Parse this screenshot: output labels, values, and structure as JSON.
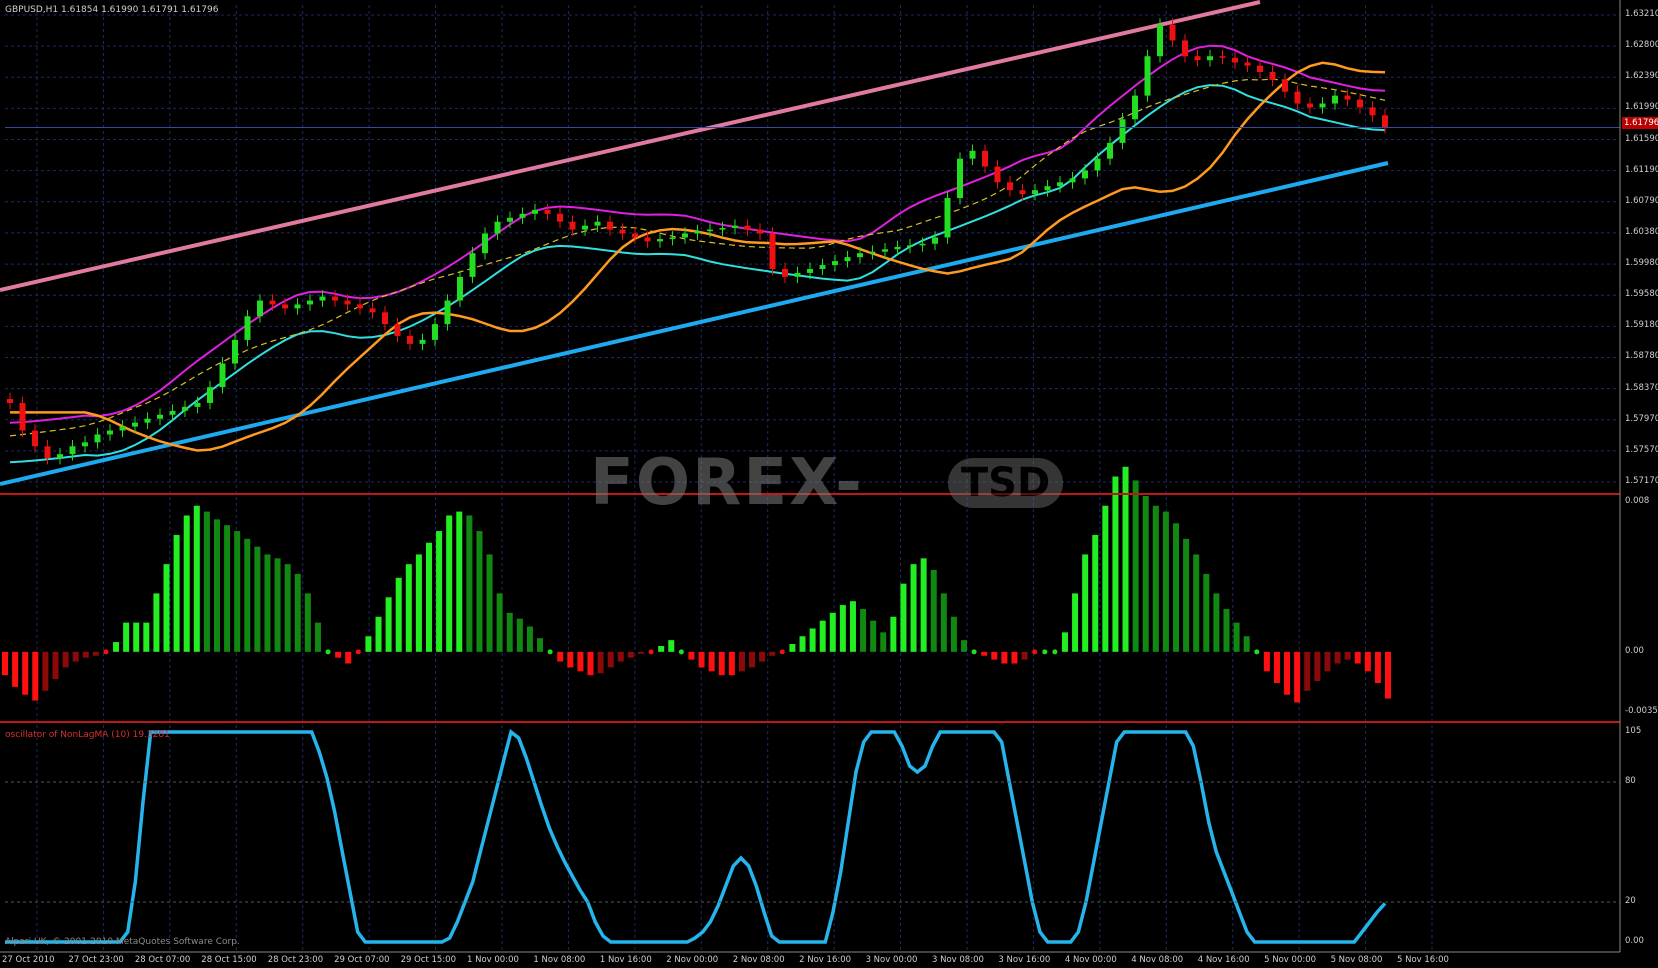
{
  "window": {
    "title": "GBPUSD,H1  1.61854 1.61990 1.61791 1.61796"
  },
  "indicator": {
    "title": "oscillator of NonLagMA (10) 19.3281"
  },
  "footer": {
    "copyright": "Alpari UK, © 2001-2010 MetaQuotes Software Corp."
  },
  "watermark": {
    "main": "FOREX-",
    "badge": "TSD"
  },
  "price_axis": [
    "1.63210",
    "1.62800",
    "1.62390",
    "1.61990",
    "1.61590",
    "1.61190",
    "1.60790",
    "1.60380",
    "1.59980",
    "1.59580",
    "1.59180",
    "1.58780",
    "1.58370",
    "1.57970",
    "1.57570",
    "1.57170"
  ],
  "current_price": "1.61796",
  "hist_axis": [
    "0.008",
    "0.00",
    "-0.0035"
  ],
  "osc_axis": [
    "105",
    "80",
    "20",
    "0.00"
  ],
  "time_axis": [
    "27 Oct 2010",
    "27 Oct 23:00",
    "28 Oct 07:00",
    "28 Oct 15:00",
    "28 Oct 23:00",
    "29 Oct 07:00",
    "29 Oct 15:00",
    "1 Nov 00:00",
    "1 Nov 08:00",
    "1 Nov 16:00",
    "2 Nov 00:00",
    "2 Nov 08:00",
    "2 Nov 16:00",
    "3 Nov 00:00",
    "3 Nov 08:00",
    "3 Nov 16:00",
    "4 Nov 00:00",
    "4 Nov 08:00",
    "4 Nov 16:00",
    "5 Nov 00:00",
    "5 Nov 08:00",
    "5 Nov 16:00"
  ],
  "colors": {
    "bull": "#22dd22",
    "bear": "#ee1111",
    "channel": "#e07aa0",
    "support": "#1eaaf0",
    "band_upper": "#e020e0",
    "band_lower": "#30e0e0",
    "orange_ma": "#ff9a20",
    "dashed_ma": "#d8c020",
    "grid": "#1c2a66",
    "osc_line": "#25b5ec"
  },
  "chart_data": [
    {
      "type": "candlestick",
      "title": "GBPUSD,H1",
      "ylim": [
        1.5717,
        1.6335
      ],
      "x_range": [
        "27 Oct 2010",
        "5 Nov 16:00"
      ],
      "close": [
        1.583,
        1.5795,
        1.5775,
        1.576,
        1.5765,
        1.5775,
        1.578,
        1.579,
        1.5795,
        1.58,
        1.5805,
        1.581,
        1.5815,
        1.582,
        1.5825,
        1.583,
        1.585,
        1.588,
        1.591,
        1.594,
        1.596,
        1.5955,
        1.595,
        1.5955,
        1.596,
        1.5965,
        1.596,
        1.5955,
        1.595,
        1.5945,
        1.593,
        1.5915,
        1.5905,
        1.591,
        1.593,
        1.596,
        1.599,
        1.602,
        1.6045,
        1.606,
        1.6065,
        1.607,
        1.6075,
        1.607,
        1.606,
        1.605,
        1.6055,
        1.606,
        1.605,
        1.6045,
        1.604,
        1.6035,
        1.6038,
        1.604,
        1.6045,
        1.6048,
        1.605,
        1.6052,
        1.6055,
        1.605,
        1.6045,
        1.6,
        1.599,
        1.5995,
        1.6,
        1.6005,
        1.601,
        1.6015,
        1.602,
        1.6022,
        1.6025,
        1.6028,
        1.603,
        1.6032,
        1.604,
        1.609,
        1.614,
        1.615,
        1.613,
        1.611,
        1.61,
        1.6095,
        1.61,
        1.6105,
        1.611,
        1.6115,
        1.6125,
        1.614,
        1.616,
        1.619,
        1.622,
        1.627,
        1.631,
        1.629,
        1.627,
        1.6265,
        1.627,
        1.6268,
        1.6262,
        1.6258,
        1.625,
        1.624,
        1.6225,
        1.621,
        1.6205,
        1.621,
        1.622,
        1.6215,
        1.6205,
        1.6195,
        1.618
      ],
      "current": 1.61796
    },
    {
      "type": "bar",
      "title": "",
      "ylim": [
        -0.0035,
        0.008
      ],
      "values": [
        -0.0012,
        -0.0018,
        -0.0022,
        -0.0025,
        -0.002,
        -0.0014,
        -0.0008,
        -0.0005,
        -0.0003,
        -0.0002,
        0.0,
        0.0005,
        0.0015,
        0.0015,
        0.0015,
        0.003,
        0.0045,
        0.006,
        0.007,
        0.0075,
        0.0072,
        0.0068,
        0.0065,
        0.0062,
        0.0058,
        0.0054,
        0.005,
        0.0048,
        0.0045,
        0.004,
        0.003,
        0.0015,
        0.0,
        -0.0003,
        -0.0006,
        0.0,
        0.0008,
        0.0018,
        0.0028,
        0.0038,
        0.0045,
        0.005,
        0.0056,
        0.0062,
        0.007,
        0.0072,
        0.007,
        0.0062,
        0.005,
        0.003,
        0.002,
        0.0017,
        0.0013,
        0.0007,
        0.0,
        -0.0005,
        -0.0008,
        -0.001,
        -0.0012,
        -0.0011,
        -0.0008,
        -0.0005,
        -0.0003,
        -0.0001,
        0.0,
        0.0003,
        0.0006,
        0.0,
        -0.0004,
        -0.0008,
        -0.001,
        -0.0012,
        -0.0012,
        -0.001,
        -0.0008,
        -0.0005,
        -0.0002,
        0.0,
        0.0004,
        0.0008,
        0.0012,
        0.0016,
        0.002,
        0.0024,
        0.0026,
        0.0022,
        0.0016,
        0.001,
        0.0018,
        0.0035,
        0.0045,
        0.0048,
        0.0042,
        0.003,
        0.0018,
        0.0006,
        0.0,
        -0.0002,
        -0.0004,
        -0.0006,
        -0.0006,
        -0.0004,
        0.0,
        0.0,
        0.0,
        0.001,
        0.003,
        0.005,
        0.006,
        0.0075,
        0.009,
        0.0095,
        0.0088,
        0.008,
        0.0075,
        0.0072,
        0.0066,
        0.0058,
        0.005,
        0.004,
        0.003,
        0.0022,
        0.0015,
        0.0008,
        0.0,
        -0.001,
        -0.0016,
        -0.0022,
        -0.0026,
        -0.002,
        -0.0015,
        -0.001,
        -0.0006,
        -0.0004,
        -0.0006,
        -0.001,
        -0.0016,
        -0.0024
      ]
    },
    {
      "type": "line",
      "title": "oscillator of NonLagMA (10) 19.3281",
      "ylim": [
        0,
        105
      ],
      "levels": [
        80,
        20
      ],
      "values": [
        0,
        0,
        0,
        0,
        0,
        0,
        0,
        0,
        0,
        0,
        0,
        0,
        0,
        0,
        0,
        0,
        5,
        30,
        70,
        105,
        105,
        105,
        105,
        105,
        105,
        105,
        105,
        105,
        105,
        105,
        105,
        105,
        105,
        105,
        105,
        105,
        105,
        105,
        105,
        105,
        105,
        95,
        82,
        65,
        45,
        25,
        5,
        0,
        0,
        0,
        0,
        0,
        0,
        0,
        0,
        0,
        0,
        0,
        2,
        10,
        20,
        30,
        45,
        60,
        75,
        90,
        105,
        102,
        92,
        80,
        68,
        57,
        48,
        40,
        33,
        26,
        20,
        10,
        3,
        0,
        0,
        0,
        0,
        0,
        0,
        0,
        0,
        0,
        0,
        0,
        2,
        5,
        10,
        18,
        28,
        38,
        42,
        38,
        28,
        15,
        3,
        0,
        0,
        0,
        0,
        0,
        0,
        0,
        15,
        35,
        60,
        85,
        100,
        105,
        105,
        105,
        105,
        98,
        88,
        85,
        88,
        98,
        105,
        105,
        105,
        105,
        105,
        105,
        105,
        105,
        100,
        80,
        60,
        40,
        20,
        5,
        0,
        0,
        0,
        0,
        5,
        20,
        40,
        60,
        80,
        100,
        105,
        105,
        105,
        105,
        105,
        105,
        105,
        105,
        105,
        98,
        80,
        60,
        45,
        35,
        25,
        15,
        5,
        0,
        0,
        0,
        0,
        0,
        0,
        0,
        0,
        0,
        0,
        0,
        0,
        0,
        0,
        5,
        10,
        15,
        19.3
      ]
    }
  ]
}
